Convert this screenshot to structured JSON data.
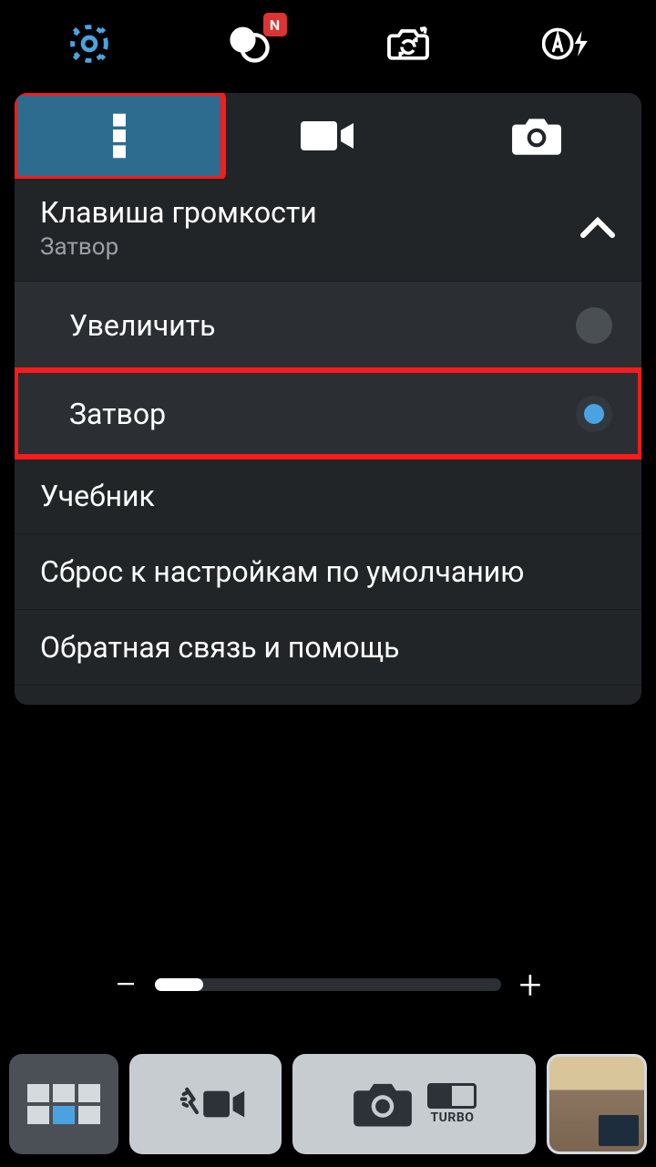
{
  "topbar": {
    "settings_icon": "gear",
    "filter_icon": "circles",
    "filter_badge": "N",
    "switch_cam_icon": "switch",
    "flash_icon": "auto-flash"
  },
  "tabs": {
    "more": "more",
    "video": "video",
    "photo": "photo"
  },
  "settings": {
    "volume_key": {
      "title": "Клавиша громкости",
      "subtitle": "Затвор"
    },
    "options": {
      "zoom": "Увеличить",
      "shutter": "Затвор"
    },
    "tutorial": "Учебник",
    "reset": "Сброс к настройкам по умолчанию",
    "feedback": "Обратная связь и помощь"
  },
  "zoom": {
    "minus": "−",
    "plus": "+",
    "value_pct": 14
  },
  "bottombar": {
    "turbo": "TURBO"
  }
}
